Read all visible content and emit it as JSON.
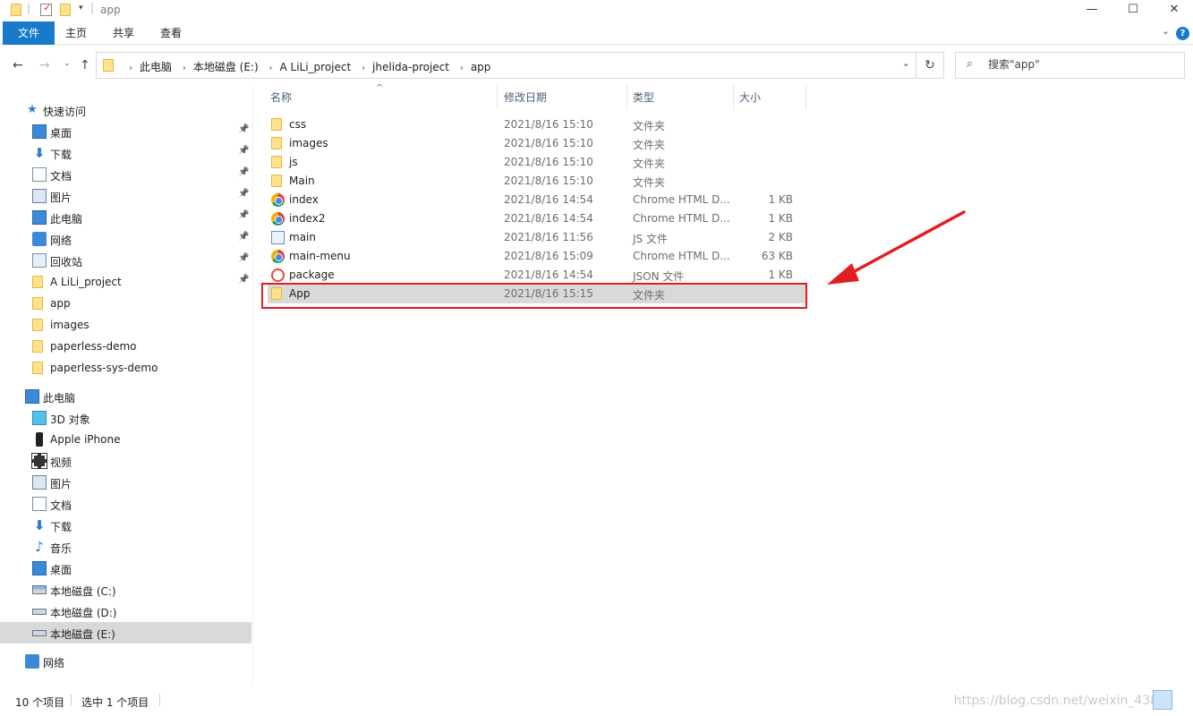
{
  "window": {
    "title": "app",
    "controls": {
      "minimize": "—",
      "maximize": "☐",
      "close": "✕"
    }
  },
  "ribbon": {
    "tabs": [
      "文件",
      "主页",
      "共享",
      "查看"
    ],
    "help": "?"
  },
  "address": {
    "crumbs": [
      "此电脑",
      "本地磁盘 (E:)",
      "A LiLi_project",
      "jhelida-project",
      "app"
    ],
    "search_placeholder": "搜索\"app\""
  },
  "sidebar": {
    "quick_access_label": "快速访问",
    "quick_access": [
      {
        "label": "桌面",
        "icon": "desktop-icon",
        "pinned": true
      },
      {
        "label": "下载",
        "icon": "download-icon",
        "pinned": true
      },
      {
        "label": "文档",
        "icon": "document-icon",
        "pinned": true
      },
      {
        "label": "图片",
        "icon": "picture-icon",
        "pinned": true
      },
      {
        "label": "此电脑",
        "icon": "computer-icon",
        "pinned": true
      },
      {
        "label": "网络",
        "icon": "network-icon",
        "pinned": true
      },
      {
        "label": "回收站",
        "icon": "recycle-bin-icon",
        "pinned": true
      },
      {
        "label": "A LiLi_project",
        "icon": "folder-icon",
        "pinned": true
      },
      {
        "label": "app",
        "icon": "folder-icon",
        "pinned": false
      },
      {
        "label": "images",
        "icon": "folder-icon",
        "pinned": false
      },
      {
        "label": "paperless-demo",
        "icon": "folder-icon",
        "pinned": false
      },
      {
        "label": "paperless-sys-demo",
        "icon": "folder-icon",
        "pinned": false
      }
    ],
    "this_pc_label": "此电脑",
    "this_pc": [
      {
        "label": "3D 对象",
        "icon": "3d-objects-icon"
      },
      {
        "label": "Apple iPhone",
        "icon": "phone-icon"
      },
      {
        "label": "视频",
        "icon": "video-icon"
      },
      {
        "label": "图片",
        "icon": "picture-icon"
      },
      {
        "label": "文档",
        "icon": "document-icon"
      },
      {
        "label": "下载",
        "icon": "download-icon"
      },
      {
        "label": "音乐",
        "icon": "music-icon"
      },
      {
        "label": "桌面",
        "icon": "desktop-icon"
      },
      {
        "label": "本地磁盘 (C:)",
        "icon": "system-drive-icon"
      },
      {
        "label": "本地磁盘 (D:)",
        "icon": "drive-icon"
      },
      {
        "label": "本地磁盘 (E:)",
        "icon": "drive-icon",
        "selected": true
      }
    ],
    "network_label": "网络"
  },
  "columns": {
    "name": "名称",
    "date": "修改日期",
    "type": "类型",
    "size": "大小"
  },
  "files": [
    {
      "name": "css",
      "date": "2021/8/16 15:10",
      "type": "文件夹",
      "size": "",
      "icon": "folder-icon"
    },
    {
      "name": "images",
      "date": "2021/8/16 15:10",
      "type": "文件夹",
      "size": "",
      "icon": "folder-icon"
    },
    {
      "name": "js",
      "date": "2021/8/16 15:10",
      "type": "文件夹",
      "size": "",
      "icon": "folder-icon"
    },
    {
      "name": "Main",
      "date": "2021/8/16 15:10",
      "type": "文件夹",
      "size": "",
      "icon": "folder-icon"
    },
    {
      "name": "index",
      "date": "2021/8/16 14:54",
      "type": "Chrome HTML D...",
      "size": "1 KB",
      "icon": "chrome-html-icon"
    },
    {
      "name": "index2",
      "date": "2021/8/16 14:54",
      "type": "Chrome HTML D...",
      "size": "1 KB",
      "icon": "chrome-html-icon"
    },
    {
      "name": "main",
      "date": "2021/8/16 11:56",
      "type": "JS 文件",
      "size": "2 KB",
      "icon": "js-file-icon"
    },
    {
      "name": "main-menu",
      "date": "2021/8/16 15:09",
      "type": "Chrome HTML D...",
      "size": "63 KB",
      "icon": "chrome-html-icon"
    },
    {
      "name": "package",
      "date": "2021/8/16 14:54",
      "type": "JSON 文件",
      "size": "1 KB",
      "icon": "json-file-icon"
    },
    {
      "name": "App",
      "date": "2021/8/16 15:15",
      "type": "文件夹",
      "size": "",
      "icon": "folder-icon",
      "selected": true
    }
  ],
  "status": {
    "count": "10 个项目",
    "selection": "选中 1 个项目"
  },
  "watermark": "https://blog.csdn.net/weixin_4385",
  "colors": {
    "accent": "#1979ca",
    "selection": "#d9d9d9",
    "annotation_red": "#e11f1f"
  }
}
